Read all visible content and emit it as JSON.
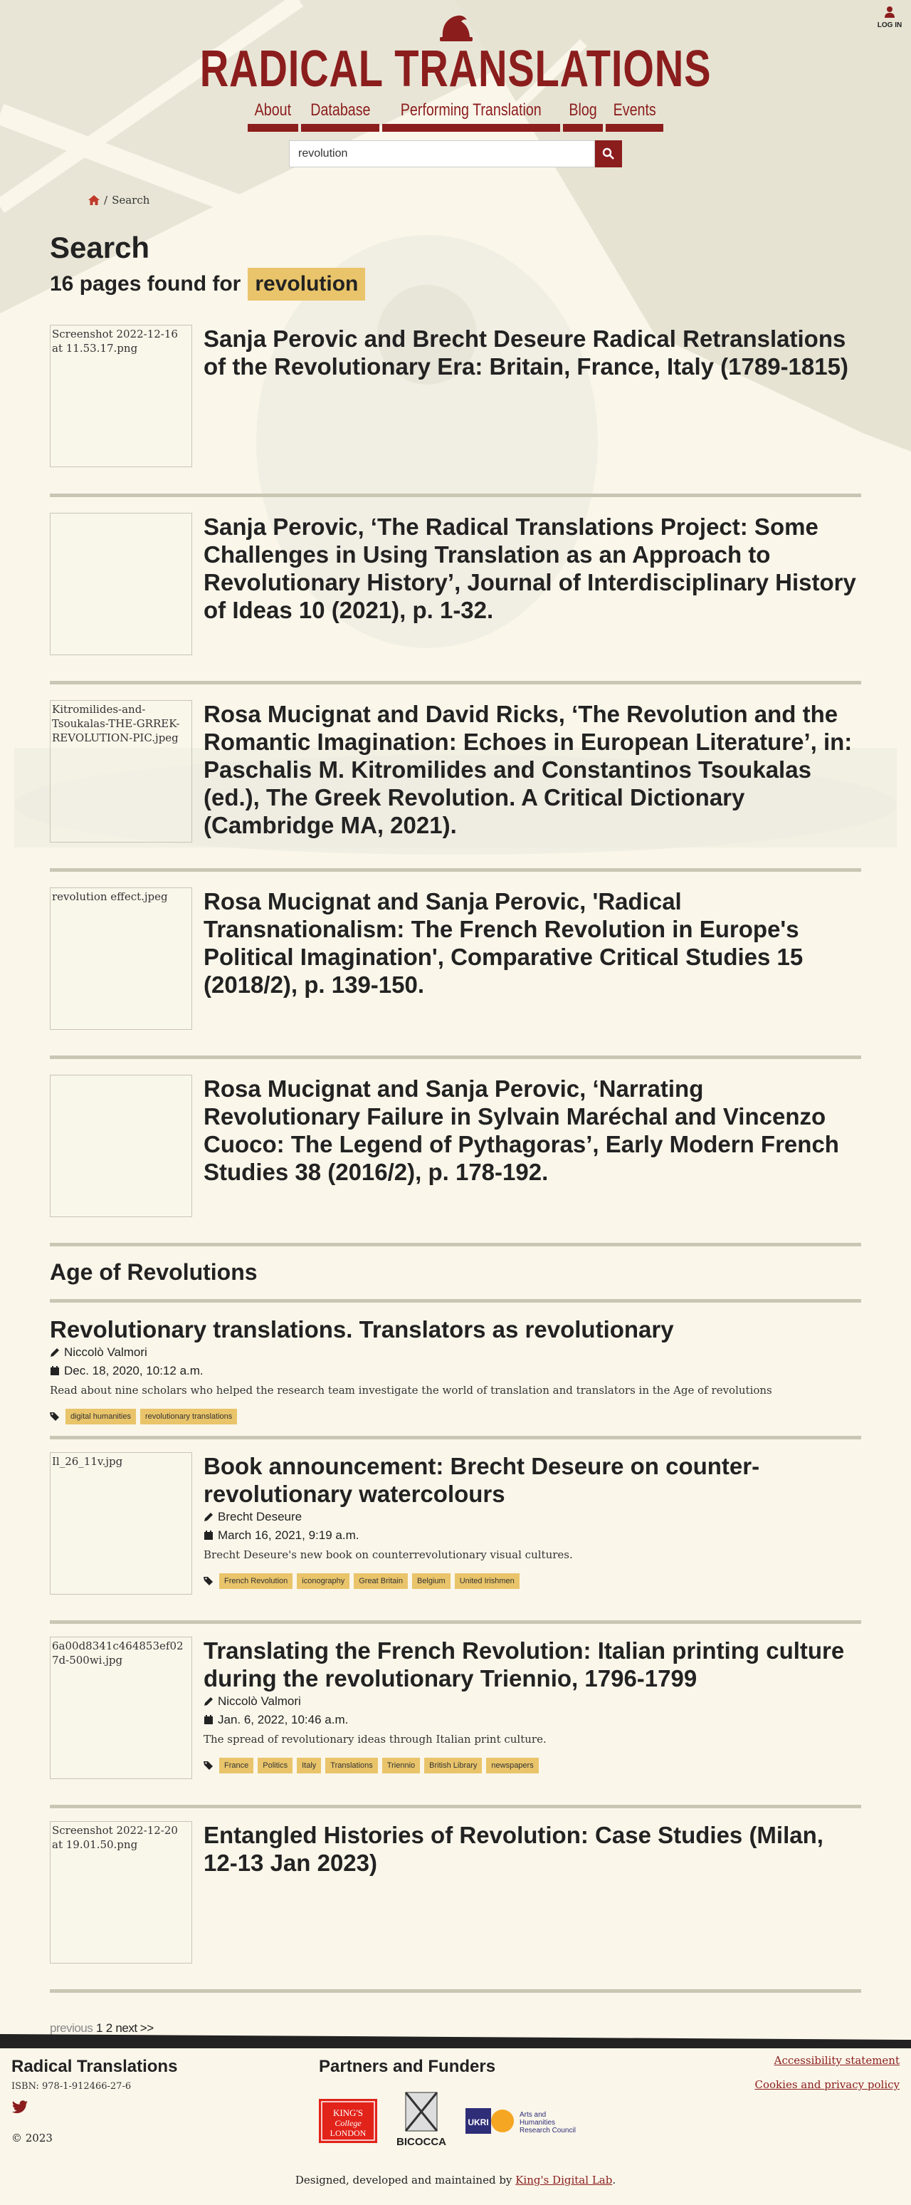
{
  "header": {
    "site_title": "RADICAL TRANSLATIONS",
    "login_label": "LOG IN",
    "nav": [
      "About",
      "Database",
      "Performing Translation",
      "Blog",
      "Events"
    ],
    "search_value": "revolution"
  },
  "breadcrumb": {
    "current": "Search",
    "separator": "/"
  },
  "search": {
    "heading": "Search",
    "found_text": "16 pages found for",
    "keyword": "revolution"
  },
  "results": [
    {
      "image_alt": "Screenshot 2022-12-16 at 11.53.17.png",
      "title": "Sanja Perovic and Brecht Deseure Radical Retranslations of the Revolutionary Era: Britain, France, Italy (1789-1815)"
    },
    {
      "image_alt": "",
      "title": "Sanja Perovic, ‘The Radical Translations Project: Some Challenges in Using Translation as an Approach to Revolutionary History’, Journal of Interdisciplinary History of Ideas 10 (2021), p. 1-32."
    },
    {
      "image_alt": "Kitromilides-and-Tsoukalas-THE-GRREK-REVOLUTION-PIC.jpeg",
      "title": "Rosa Mucignat and David Ricks, ‘The Revolution and the Romantic Imagination: Echoes in European Literature’, in: Paschalis M. Kitromilides and Constantinos Tsoukalas (ed.), The Greek Revolution. A Critical Dictionary (Cambridge MA, 2021)."
    },
    {
      "image_alt": "revolution effect.jpeg",
      "title": "Rosa Mucignat and Sanja Perovic, 'Radical Transnationalism: The French Revolution in Europe's Political Imagination', Comparative Critical Studies 15 (2018/2), p. 139-150."
    },
    {
      "image_alt": "",
      "title": "Rosa Mucignat and Sanja Perovic, ‘Narrating Revolutionary Failure in Sylvain Maréchal and Vincenzo Cuoco: The Legend of Pythagoras’, Early Modern French Studies 38 (2016/2), p. 178-192."
    }
  ],
  "section_heading": "Age of Revolutions",
  "blog_first": {
    "title": "Revolutionary translations. Translators as revolutionary",
    "author": "Niccolò Valmori",
    "date": "Dec. 18, 2020, 10:12 a.m.",
    "excerpt": "Read about nine scholars who helped the research team investigate the world of translation and translators in the Age of revolutions",
    "tags": [
      "digital humanities",
      "revolutionary translations"
    ]
  },
  "blog_posts": [
    {
      "image_alt": "Il_26_11v.jpg",
      "title": "Book announcement: Brecht Deseure on counter-revolutionary watercolours",
      "author": "Brecht Deseure",
      "date": "March 16, 2021, 9:19 a.m.",
      "excerpt": "Brecht Deseure's new book on counterrevolutionary visual cultures.",
      "tags": [
        "French Revolution",
        "iconography",
        "Great Britain",
        "Belgium",
        "United Irishmen"
      ]
    },
    {
      "image_alt": "6a00d8341c464853ef027d-500wi.jpg",
      "title": "Translating the French Revolution: Italian printing culture during the revolutionary Triennio, 1796-1799",
      "author": "Niccolò Valmori",
      "date": "Jan. 6, 2022, 10:46 a.m.",
      "excerpt": "The spread of revolutionary ideas through Italian print culture.",
      "tags": [
        "France",
        "Politics",
        "Italy",
        "Translations",
        "Triennio",
        "British Library",
        "newspapers"
      ]
    }
  ],
  "last_result": {
    "image_alt": "Screenshot 2022-12-20 at 19.01.50.png",
    "title": "Entangled Histories of Revolution: Case Studies (Milan, 12-13 Jan 2023)"
  },
  "pagination": {
    "previous": "previous",
    "pages": [
      "1",
      "2"
    ],
    "next": "next >>"
  },
  "footer": {
    "title": "Radical Translations",
    "isbn": "ISBN: 978-1-912466-27-6",
    "copyright": "© 2023",
    "partners_heading": "Partners and Funders",
    "partners": [
      "King's College London",
      "Università degli Studi di Milano Bicocca",
      "UKRI Arts and Humanities Research Council"
    ],
    "links": [
      "Accessibility statement",
      "Cookies and privacy policy"
    ],
    "credit_prefix": "Designed, developed and maintained by",
    "credit_link": "King's Digital Lab",
    "credit_suffix": "."
  },
  "colors": {
    "brand": "#8b1d1d",
    "highlight": "#e9c46a",
    "background": "#faf6ea",
    "rule": "#c9c6b4"
  }
}
